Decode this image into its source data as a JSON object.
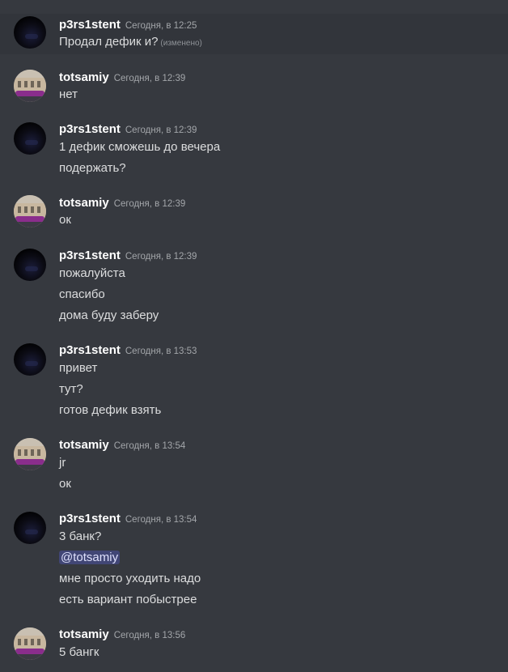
{
  "messages": [
    {
      "user": "p3rs1stent",
      "time": "Сегодня, в 12:25",
      "lines": [
        "Продал дефик и?"
      ],
      "edited": "(изменено)"
    },
    {
      "user": "totsamiy",
      "time": "Сегодня, в 12:39",
      "lines": [
        "нет"
      ]
    },
    {
      "user": "p3rs1stent",
      "time": "Сегодня, в 12:39",
      "lines": [
        "1 дефик сможешь до вечера",
        "подержать?"
      ]
    },
    {
      "user": "totsamiy",
      "time": "Сегодня, в 12:39",
      "lines": [
        "ок"
      ]
    },
    {
      "user": "p3rs1stent",
      "time": "Сегодня, в 12:39",
      "lines": [
        "пожалуйста",
        "спасибо",
        "дома буду заберу"
      ]
    },
    {
      "user": "p3rs1stent",
      "time": "Сегодня, в 13:53",
      "lines": [
        "привет",
        "тут?",
        "готов дефик взять"
      ]
    },
    {
      "user": "totsamiy",
      "time": "Сегодня, в 13:54",
      "lines": [
        "jr",
        "ок"
      ]
    },
    {
      "user": "p3rs1stent",
      "time": "Сегодня, в 13:54",
      "lines": [
        "3 банк?",
        "@totsamiy",
        "мне просто уходить надо",
        "есть вариант побыстрее"
      ]
    },
    {
      "user": "totsamiy",
      "time": "Сегодня, в 13:56",
      "lines": [
        "5 бангк"
      ]
    }
  ],
  "colors": {
    "background": "#36393f",
    "highlight": "#32353b",
    "username": "#ffffff",
    "timestamp": "#a3a6aa",
    "text": "#dcddde",
    "mention_bg": "#414675"
  },
  "icons": {
    "p3rs1stent_avatar": "dark-car-avatar",
    "totsamiy_avatar": "building-avatar"
  }
}
